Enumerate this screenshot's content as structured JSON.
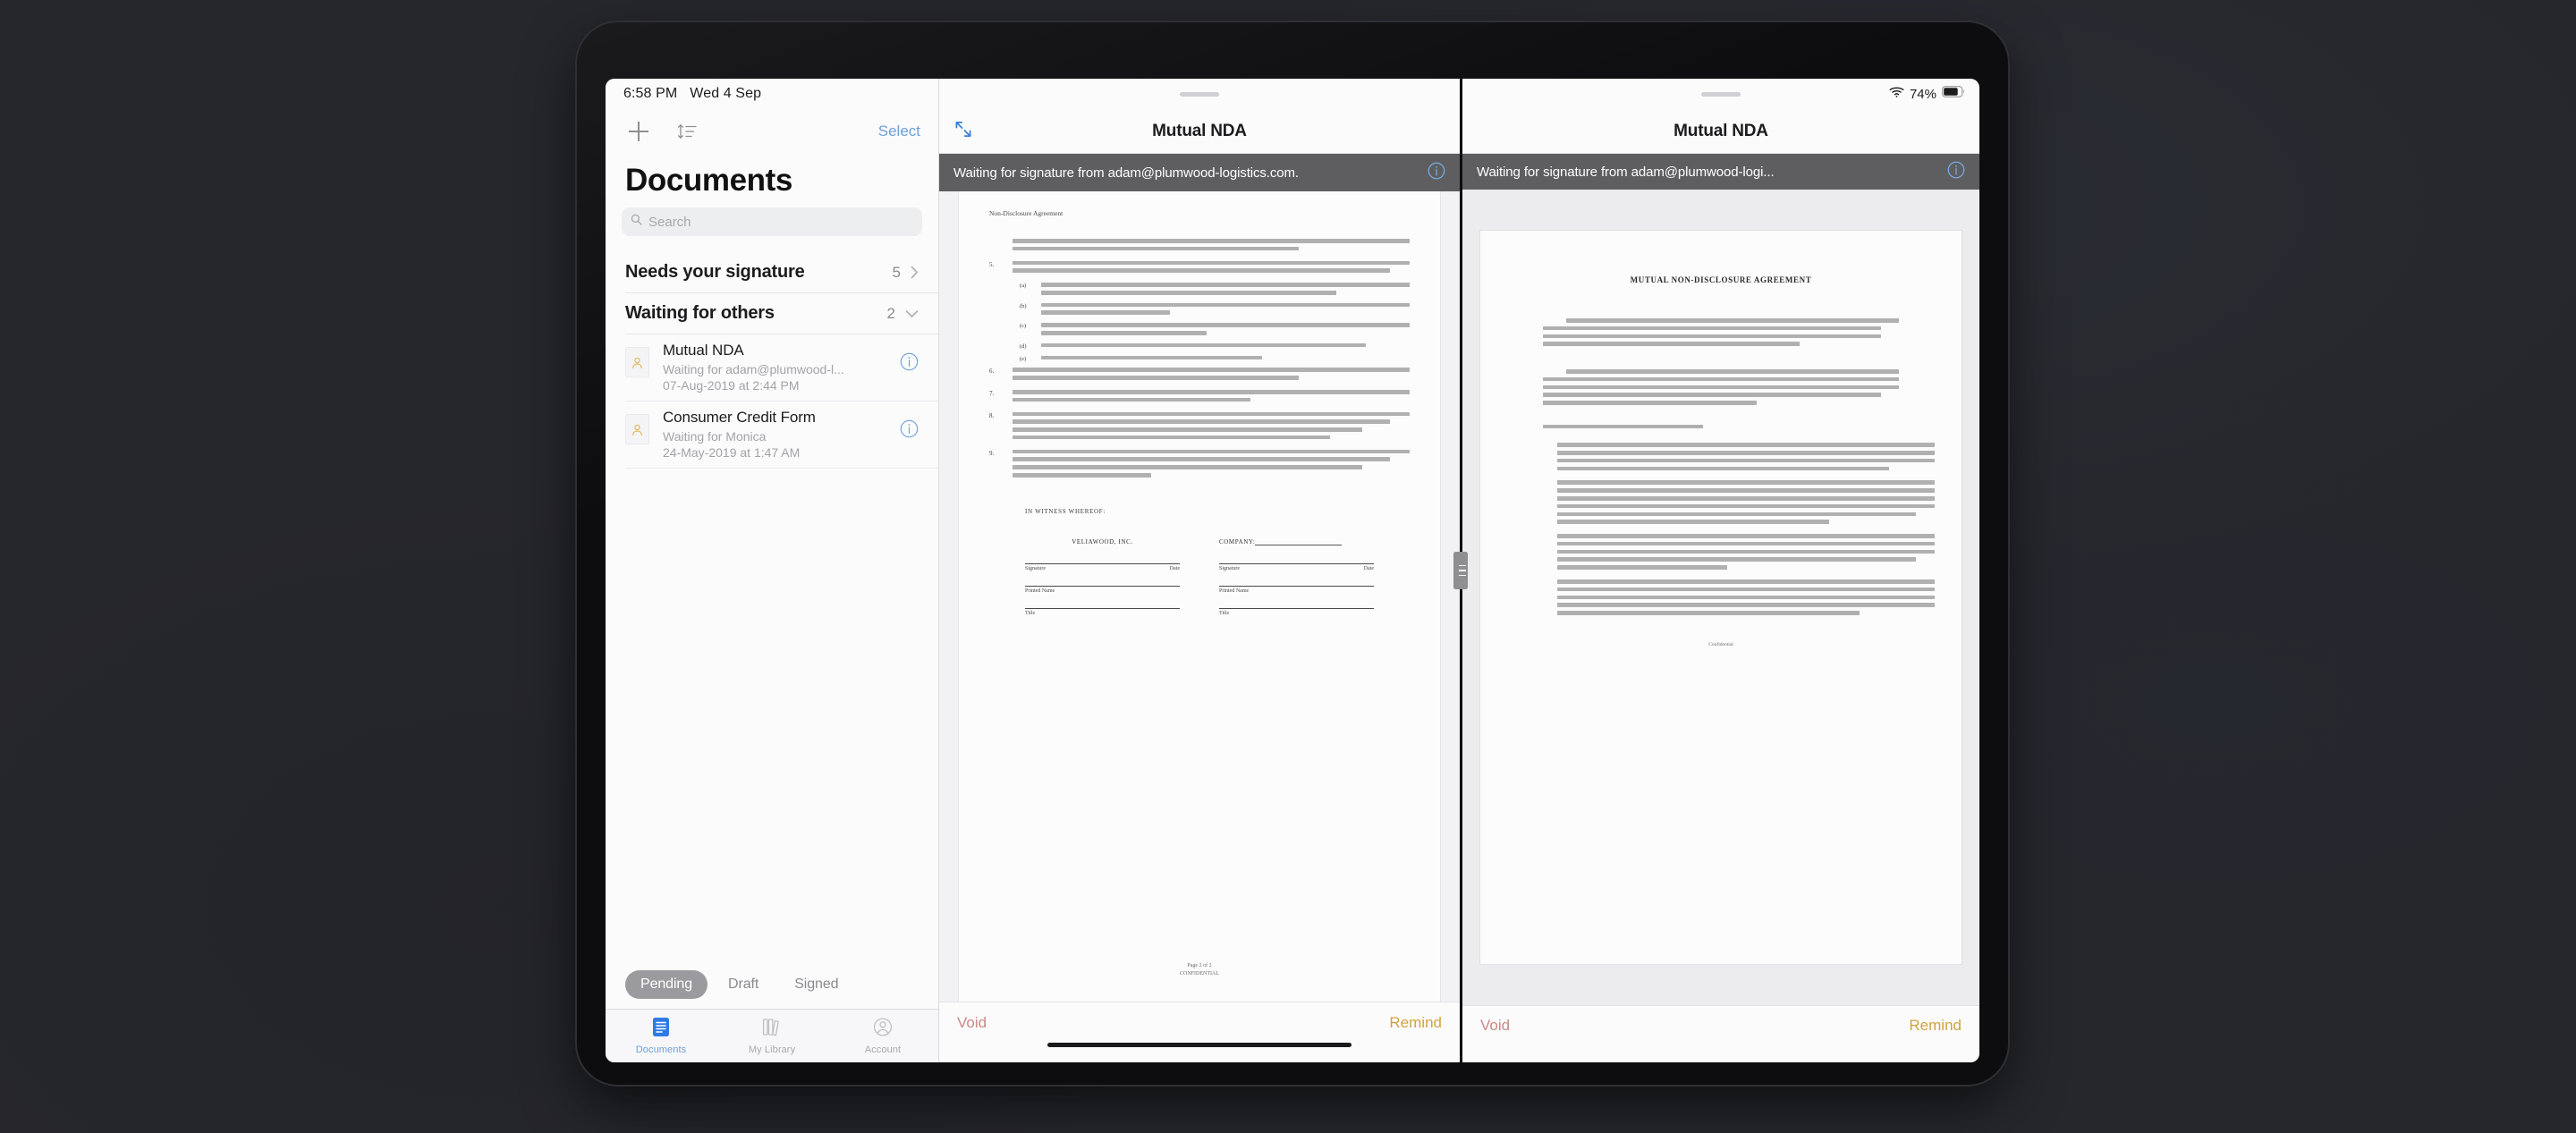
{
  "status_bar": {
    "time": "6:58 PM",
    "date": "Wed 4 Sep",
    "battery_percent": "74%",
    "wifi_icon": "wifi-icon",
    "battery_icon": "battery-icon"
  },
  "sidebar": {
    "toolbar": {
      "add_icon": "plus-icon",
      "sort_icon": "sort-icon",
      "select_label": "Select"
    },
    "page_title": "Documents",
    "search": {
      "placeholder": "Search",
      "icon": "search-icon",
      "value": ""
    },
    "sections": [
      {
        "label": "Needs your signature",
        "count": "5",
        "chevron": "chevron-right-icon",
        "expanded": false
      },
      {
        "label": "Waiting for others",
        "count": "2",
        "chevron": "chevron-down-icon",
        "expanded": true
      }
    ],
    "documents": [
      {
        "title": "Mutual NDA",
        "subtitle": "Waiting for adam@plumwood-l...",
        "date": "07-Aug-2019 at 2:44 PM",
        "thumb_icon": "person-document-icon",
        "info_icon": "info-circle-icon"
      },
      {
        "title": "Consumer Credit Form",
        "subtitle": "Waiting for Monica",
        "date": "24-May-2019 at 1:47 AM",
        "thumb_icon": "person-document-icon",
        "info_icon": "info-circle-icon"
      }
    ],
    "segmented": {
      "options": [
        "Pending",
        "Draft",
        "Signed"
      ],
      "selected": "Pending"
    },
    "tabs": [
      {
        "label": "Documents",
        "icon": "document-icon",
        "active": true
      },
      {
        "label": "My Library",
        "icon": "library-icon",
        "active": false
      },
      {
        "label": "Account",
        "icon": "account-icon",
        "active": false
      }
    ]
  },
  "doc_pane": {
    "expand_icon": "expand-arrows-icon",
    "title": "Mutual NDA",
    "banner": {
      "text": "Waiting for signature from adam@plumwood-logistics.com.",
      "info_icon": "info-circle-icon"
    },
    "actions": {
      "void_label": "Void",
      "remind_label": "Remind"
    },
    "document": {
      "header": "Non-Disclosure Agreement",
      "witness_heading": "IN WITNESS WHEREOF:",
      "signature_blocks": [
        {
          "company": "VELIAWOOD, INC.",
          "signature_label": "Signature",
          "date_label": "Date",
          "printed_name_label": "Printed Name",
          "title_label": "Title"
        },
        {
          "company": "COMPANY:",
          "signature_label": "Signature",
          "date_label": "Date",
          "printed_name_label": "Printed Name",
          "title_label": "Title"
        }
      ],
      "footer_page": "Page 2 of 2",
      "footer_conf": "CONFIDENTIAL",
      "clause_numbers": [
        "5.",
        "6.",
        "7.",
        "8.",
        "9."
      ],
      "sub_markers": [
        "(a)",
        "(b)",
        "(c)",
        "(d)",
        "(e)"
      ]
    }
  },
  "right_pane": {
    "title": "Mutual NDA",
    "banner": {
      "text": "Waiting for signature from adam@plumwood-logi...",
      "info_icon": "info-circle-icon"
    },
    "actions": {
      "void_label": "Void",
      "remind_label": "Remind"
    },
    "document": {
      "title": "MUTUAL NON-DISCLOSURE AGREEMENT",
      "footer_conf": "Confidential"
    }
  },
  "handles": {
    "left_divider": "split-view-drag-handle",
    "right_divider": "split-view-drag-handle"
  },
  "colors": {
    "accent_blue": "#6e9fd8",
    "void_red": "#c98a86",
    "remind_gold": "#d3a23f",
    "banner_gray": "#5e5e60",
    "segment_active": "#9b9b9f"
  }
}
